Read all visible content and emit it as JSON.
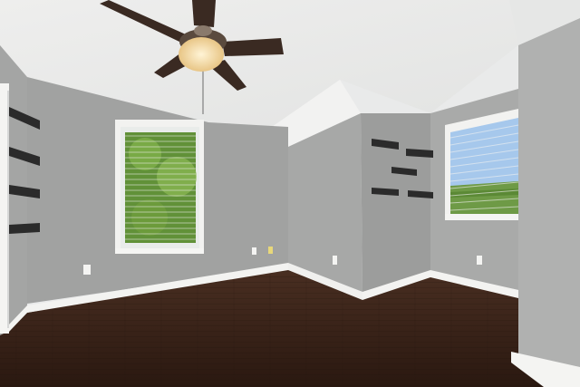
{
  "scene": {
    "description_visible_text": "",
    "colors": {
      "ceiling": "#ececeb",
      "ceiling_shadow": "#dcdddc",
      "wall_left": "#a6a7a6",
      "wall_back": "#9fa09f",
      "wall_pillar": "#a8a9a8",
      "wall_right_back": "#a9aaa9",
      "wall_right": "#b1b2b1",
      "baseboard": "#f4f4f2",
      "floor_dark": "#2e1c14",
      "floor_mid": "#4a2f22",
      "window_frame": "#f3f3f1",
      "foliage": "#5f8f3a",
      "sky": "#9fc3ea",
      "fan_blade": "#3a2a22",
      "fan_light": "#f3d9a0",
      "shelf": "#2a2a2a"
    },
    "icons": {
      "ceiling_fan": "ceiling-fan-icon",
      "left_shelves": "wall-shelf-icon",
      "pillar_shelves": "floating-shelf-icon",
      "outlets": "electrical-outlet-icon"
    }
  }
}
